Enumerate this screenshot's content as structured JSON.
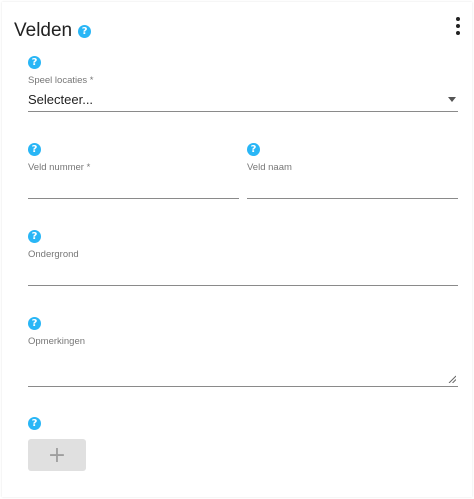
{
  "card": {
    "title": "Velden",
    "help_glyph": "?",
    "menu_icon": "more-vert-icon"
  },
  "fields": {
    "speel_locaties": {
      "label": "Speel locaties *",
      "value": "Selecteer..."
    },
    "veld_nummer": {
      "label": "Veld nummer *",
      "value": ""
    },
    "veld_naam": {
      "label": "Veld naam",
      "value": ""
    },
    "ondergrond": {
      "label": "Ondergrond",
      "value": ""
    },
    "opmerkingen": {
      "label": "Opmerkingen",
      "value": ""
    }
  },
  "add_button": {
    "label": "+"
  },
  "colors": {
    "help_icon": "#29b6f6",
    "underline": "#8a8a8a",
    "button_bg": "#e0e0e0"
  }
}
